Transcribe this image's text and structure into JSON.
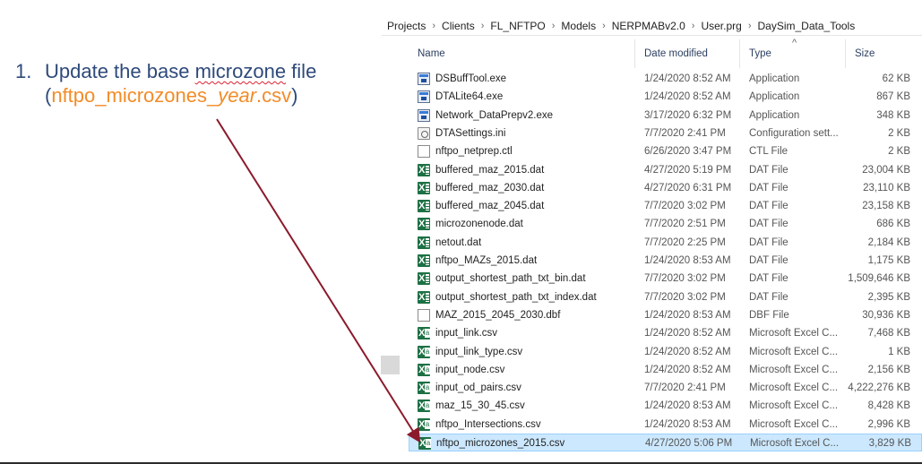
{
  "instruction": {
    "number": "1.",
    "line1_pre": "Update the base ",
    "line1_word": "microzone",
    "line1_post": " file",
    "paren_open": "(",
    "file_prefix": "nftpo_microzones_",
    "file_year": "year",
    "file_ext": ".csv",
    "paren_close": ")"
  },
  "breadcrumb": [
    "Projects",
    "Clients",
    "FL_NFTPO",
    "Models",
    "NERPMABv2.0",
    "User.prg",
    "DaySim_Data_Tools"
  ],
  "breadcrumb_separator": "›",
  "columns": {
    "name": "Name",
    "date": "Date modified",
    "type": "Type",
    "size": "Size",
    "sort_caret": "^"
  },
  "files": [
    {
      "name": "DSBuffTool.exe",
      "date": "1/24/2020 8:52 AM",
      "type": "Application",
      "size": "62 KB",
      "icon": "application-icon"
    },
    {
      "name": "DTALite64.exe",
      "date": "1/24/2020 8:52 AM",
      "type": "Application",
      "size": "867 KB",
      "icon": "application-icon"
    },
    {
      "name": "Network_DataPrepv2.exe",
      "date": "3/17/2020 6:32 PM",
      "type": "Application",
      "size": "348 KB",
      "icon": "application-icon"
    },
    {
      "name": "DTASettings.ini",
      "date": "7/7/2020 2:41 PM",
      "type": "Configuration sett...",
      "size": "2 KB",
      "icon": "settings-file-icon"
    },
    {
      "name": "nftpo_netprep.ctl",
      "date": "6/26/2020 3:47 PM",
      "type": "CTL File",
      "size": "2 KB",
      "icon": "blank-file-icon"
    },
    {
      "name": "buffered_maz_2015.dat",
      "date": "4/27/2020 5:19 PM",
      "type": "DAT File",
      "size": "23,004 KB",
      "icon": "excel-icon"
    },
    {
      "name": "buffered_maz_2030.dat",
      "date": "4/27/2020 6:31 PM",
      "type": "DAT File",
      "size": "23,110 KB",
      "icon": "excel-icon"
    },
    {
      "name": "buffered_maz_2045.dat",
      "date": "7/7/2020 3:02 PM",
      "type": "DAT File",
      "size": "23,158 KB",
      "icon": "excel-icon"
    },
    {
      "name": "microzonenode.dat",
      "date": "7/7/2020 2:51 PM",
      "type": "DAT File",
      "size": "686 KB",
      "icon": "excel-icon"
    },
    {
      "name": "netout.dat",
      "date": "7/7/2020 2:25 PM",
      "type": "DAT File",
      "size": "2,184 KB",
      "icon": "excel-icon"
    },
    {
      "name": "nftpo_MAZs_2015.dat",
      "date": "1/24/2020 8:53 AM",
      "type": "DAT File",
      "size": "1,175 KB",
      "icon": "excel-icon"
    },
    {
      "name": "output_shortest_path_txt_bin.dat",
      "date": "7/7/2020 3:02 PM",
      "type": "DAT File",
      "size": "1,509,646 KB",
      "icon": "excel-icon"
    },
    {
      "name": "output_shortest_path_txt_index.dat",
      "date": "7/7/2020 3:02 PM",
      "type": "DAT File",
      "size": "2,395 KB",
      "icon": "excel-icon"
    },
    {
      "name": "MAZ_2015_2045_2030.dbf",
      "date": "1/24/2020 8:53 AM",
      "type": "DBF File",
      "size": "30,936 KB",
      "icon": "blank-file-icon"
    },
    {
      "name": "input_link.csv",
      "date": "1/24/2020 8:52 AM",
      "type": "Microsoft Excel C...",
      "size": "7,468 KB",
      "icon": "excel-csv-icon"
    },
    {
      "name": "input_link_type.csv",
      "date": "1/24/2020 8:52 AM",
      "type": "Microsoft Excel C...",
      "size": "1 KB",
      "icon": "excel-csv-icon"
    },
    {
      "name": "input_node.csv",
      "date": "1/24/2020 8:52 AM",
      "type": "Microsoft Excel C...",
      "size": "2,156 KB",
      "icon": "excel-csv-icon"
    },
    {
      "name": "input_od_pairs.csv",
      "date": "7/7/2020 2:41 PM",
      "type": "Microsoft Excel C...",
      "size": "4,222,276 KB",
      "icon": "excel-csv-icon"
    },
    {
      "name": "maz_15_30_45.csv",
      "date": "1/24/2020 8:53 AM",
      "type": "Microsoft Excel C...",
      "size": "8,428 KB",
      "icon": "excel-csv-icon"
    },
    {
      "name": "nftpo_Intersections.csv",
      "date": "1/24/2020 8:53 AM",
      "type": "Microsoft Excel C...",
      "size": "2,996 KB",
      "icon": "excel-csv-icon"
    },
    {
      "name": "nftpo_microzones_2015.csv",
      "date": "4/27/2020 5:06 PM",
      "type": "Microsoft Excel C...",
      "size": "3,829 KB",
      "icon": "excel-csv-icon",
      "selected": true
    }
  ],
  "colors": {
    "instruction_text": "#2e4a7a",
    "filename_highlight": "#f28c28",
    "arrow": "#8b1a2b",
    "selection": "#cce8ff"
  }
}
